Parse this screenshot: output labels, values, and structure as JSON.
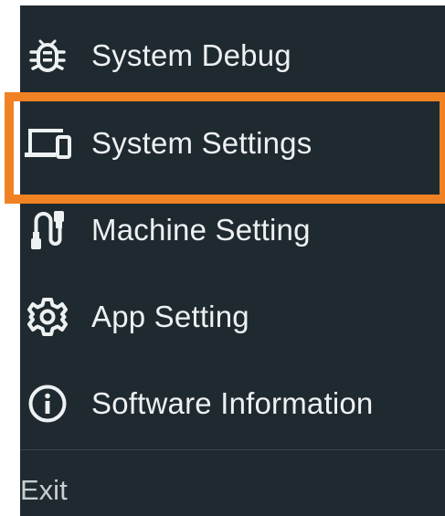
{
  "menu": {
    "items": [
      {
        "label": "System Debug",
        "icon": "bug-icon"
      },
      {
        "label": "System Settings",
        "icon": "devices-icon"
      },
      {
        "label": "Machine Setting",
        "icon": "cable-icon"
      },
      {
        "label": "App Setting",
        "icon": "gear-icon"
      },
      {
        "label": "Software Information",
        "icon": "info-icon"
      }
    ],
    "exit_label": "Exit"
  },
  "highlight": {
    "target": "System Settings",
    "color": "#f08224"
  },
  "colors": {
    "panel_background": "#1f2a30",
    "text": "#eef1f2"
  }
}
